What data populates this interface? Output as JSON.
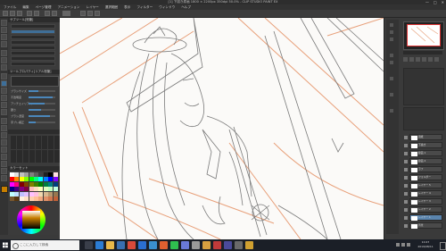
{
  "window": {
    "title": "[1] 下描き原画 1800 × 2200px 350dpi 50.0% - CLIP STUDIO PAINT EX",
    "controls": [
      "—",
      "□",
      "✕"
    ]
  },
  "menu": [
    "ファイル",
    "編集",
    "ページ管理",
    "アニメーション",
    "レイヤー",
    "選択範囲",
    "表示",
    "フィルター",
    "ウィンドウ",
    "ヘルプ"
  ],
  "subtool": {
    "header": "サブツール[鉛筆]",
    "tool_property_header": "ツールプロパティ[リアル鉛筆]",
    "props": [
      {
        "label": "ブラシサイズ",
        "value": 0.35
      },
      {
        "label": "不透明度",
        "value": 0.9
      },
      {
        "label": "アンチエイリアス",
        "value": 0.6
      },
      {
        "label": "硬さ",
        "value": 0.45
      },
      {
        "label": "ブラシ濃度",
        "value": 0.8
      },
      {
        "label": "手ブレ補正",
        "value": 0.25
      }
    ],
    "color_set_header": "カラーセット"
  },
  "colors": {
    "accent": "#4b87bb",
    "canvas_bg": "#fbfaf8",
    "sketch_orange": "#e8a07a",
    "sketch_gray": "#8a8a8a",
    "current_color": "#c87f00"
  },
  "swatches": [
    "#ffffff",
    "#e0e0e0",
    "#c0c0c0",
    "#a0a0a0",
    "#808080",
    "#606060",
    "#404040",
    "#202020",
    "#000000",
    "#ffe0e0",
    "#ff0000",
    "#ff8000",
    "#ffff00",
    "#80ff00",
    "#00ff00",
    "#00ff80",
    "#00ffff",
    "#0080ff",
    "#0000ff",
    "#8000ff",
    "#ff00ff",
    "#ff0080",
    "#800000",
    "#804000",
    "#808000",
    "#408000",
    "#008000",
    "#008040",
    "#008080",
    "#004080",
    "#000080",
    "#400080",
    "#800080",
    "#800040",
    "#ffc0c0",
    "#ffe0c0",
    "#ffffc0",
    "#e0ffc0",
    "#c0ffc0",
    "#c0ffe0",
    "#c0ffff",
    "#c0e0ff",
    "#c0c0ff",
    "#e0c0ff",
    "#ffc0ff",
    "#ffc0e0",
    "#f0d8b0",
    "#d8b890",
    "#b89870",
    "#987850",
    "#785830",
    "#583810",
    "#fff0e0",
    "#ffe0c8",
    "#ffd0b0",
    "#ffc098",
    "#f0a880",
    "#e09068",
    "#d07850",
    "#c06038"
  ],
  "layers": [
    {
      "name": "用紙"
    },
    {
      "name": "下描き"
    },
    {
      "name": "線画 1"
    },
    {
      "name": "線画 2"
    },
    {
      "name": "ラフ"
    },
    {
      "name": "フォルダー"
    },
    {
      "name": "レイヤー 5"
    },
    {
      "name": "レイヤー 4"
    },
    {
      "name": "レイヤー 3"
    },
    {
      "name": "レイヤー 2"
    },
    {
      "name": "レイヤー 1"
    },
    {
      "name": "背景"
    }
  ],
  "taskbar": {
    "search_placeholder": "ここに入力して検索",
    "time": "10:47",
    "date": "2019/08/11",
    "apps": [
      {
        "name": "task-view-icon",
        "color": "#3a3f4a"
      },
      {
        "name": "edge-icon",
        "color": "#2b7cd3"
      },
      {
        "name": "explorer-icon",
        "color": "#e8b84a"
      },
      {
        "name": "store-icon",
        "color": "#3a6fb0"
      },
      {
        "name": "chrome-icon",
        "color": "#d94a3a"
      },
      {
        "name": "mail-icon",
        "color": "#2b6fd0"
      },
      {
        "name": "photos-icon",
        "color": "#3a8fd0"
      },
      {
        "name": "media-icon",
        "color": "#e06030"
      },
      {
        "name": "line-icon",
        "color": "#2fbf4f"
      },
      {
        "name": "discord-icon",
        "color": "#6a7ad8"
      },
      {
        "name": "clipstudio-icon",
        "color": "#9a9a9a"
      },
      {
        "name": "paint-icon",
        "color": "#d8a040"
      },
      {
        "name": "music-icon",
        "color": "#c03a3a"
      },
      {
        "name": "game-icon",
        "color": "#4a4a9a"
      },
      {
        "name": "settings-icon",
        "color": "#6a6a6a"
      },
      {
        "name": "folder-icon",
        "color": "#d0a030"
      }
    ]
  }
}
